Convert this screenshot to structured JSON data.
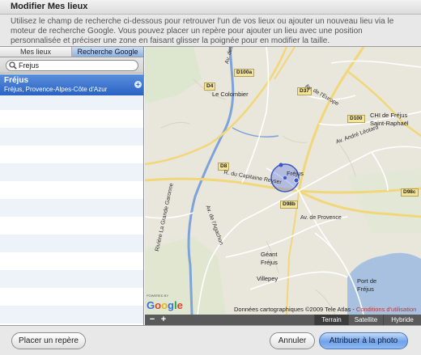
{
  "window": {
    "title": "Modifier Mes lieux"
  },
  "description": "Utilisez le champ de recherche ci-dessous pour retrouver l'un de vos lieux ou ajouter un nouveau lieu via le moteur de recherche Google. Vous pouvez placer un repère pour ajouter un lieu avec une position personnalisée et préciser une zone en faisant glisser la poignée pour en modifier la taille.",
  "tabs": [
    {
      "label": "Mes lieux",
      "active": false
    },
    {
      "label": "Recherche Google",
      "active": true
    }
  ],
  "search": {
    "value": "Frejus",
    "placeholder": ""
  },
  "results": [
    {
      "title": "Fréjus",
      "subtitle": "Fréjus, Provence-Alpes-Côte d'Azur",
      "selected": true
    }
  ],
  "map": {
    "road_labels": {
      "d100a": "D100a",
      "d4": "D4",
      "d37": "D37",
      "d100": "D100",
      "d8": "D8",
      "d98b": "D98b",
      "d98c": "D98c"
    },
    "places": {
      "colombier": "Le Colombier",
      "frejus": "Fréjus",
      "geant": "Géant",
      "frejus2": "Fréjus",
      "villepey": "Villepey",
      "port_line1": "Port de",
      "port_line2": "Fréjus",
      "chi_line1": "CHI de Fréjus",
      "chi_line2": "Saint-Raphaël"
    },
    "streets": {
      "combattants": "Av. des Combattants",
      "europe": "Av. de l'Europe",
      "capitaine": "R. du Capitaine Reyser",
      "provence": "Av. de Provence",
      "riviera": "Rivière La Grande Garonne",
      "chemin": "Av. de l'Agachon",
      "aurelienne": "Av. André Léotard"
    },
    "powered_by": "POWERED BY",
    "attribution": "Données cartographiques ©2009 Tele Atlas - ",
    "conditions": "Conditions d'utilisation",
    "zoom_out": "−",
    "zoom_in": "+",
    "types": [
      {
        "label": "Terrain",
        "active": true
      },
      {
        "label": "Satellite",
        "active": false
      },
      {
        "label": "Hybride",
        "active": false
      }
    ]
  },
  "buttons": {
    "placer": "Placer un repère",
    "annuler": "Annuler",
    "attribuer": "Attribuer à la photo"
  },
  "colors": {
    "accent": "#2a62c4",
    "water": "#a9c1e0",
    "river": "#7ea3d8",
    "map_bg": "#e9e6dc"
  }
}
